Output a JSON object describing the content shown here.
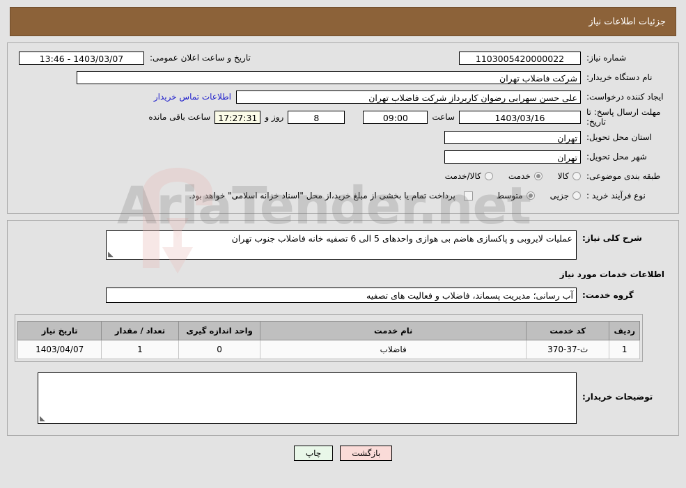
{
  "header": {
    "title": "جزئیات اطلاعات نیاز"
  },
  "watermark": {
    "text": "AriaTender.net",
    "logo_color": "#e8b9b6"
  },
  "form": {
    "need_number": {
      "label": "شماره نیاز:",
      "value": "1103005420000022"
    },
    "public_announce": {
      "label": "تاریخ و ساعت اعلان عمومی:",
      "value": "1403/03/07 - 13:46"
    },
    "buyer_org": {
      "label": "نام دستگاه خریدار:",
      "value": "شرکت فاضلاب تهران"
    },
    "creator": {
      "label": "ایجاد کننده درخواست:",
      "value": "علی حسن  سهرابی رضوان کاربرداز شرکت فاضلاب تهران"
    },
    "contact_link": "اطلاعات تماس خریدار",
    "deadline": {
      "label": "مهلت ارسال پاسخ: تا تاریخ:",
      "date": "1403/03/16",
      "hour_label": "ساعت",
      "hour": "09:00",
      "days": "8",
      "days_label": "روز و",
      "countdown": "17:27:31",
      "countdown_label": "ساعت باقی مانده"
    },
    "delivery_province": {
      "label": "استان محل تحویل:",
      "value": "تهران"
    },
    "delivery_city": {
      "label": "شهر محل تحویل:",
      "value": "تهران"
    },
    "category": {
      "label": "طبقه بندی موضوعی:",
      "options": [
        {
          "label": "کالا",
          "selected": false
        },
        {
          "label": "خدمت",
          "selected": true
        },
        {
          "label": "کالا/خدمت",
          "selected": false
        }
      ]
    },
    "purchase_type": {
      "label": "نوع فرآیند خرید :",
      "options": [
        {
          "label": "جزیی",
          "selected": false
        },
        {
          "label": "متوسط",
          "selected": true
        }
      ],
      "treasury_note": "پرداخت تمام یا بخشی از مبلغ خرید،از محل \"اسناد خزانه اسلامی\" خواهد بود.",
      "treasury_checked": false
    }
  },
  "details": {
    "general_desc": {
      "label": "شرح کلی نیاز:",
      "value": "عملیات لایروبی و پاکسازی هاضم بی هوازی واحدهای 5 الی 6 تصفیه خانه فاضلاب جنوب تهران"
    },
    "section_title": "اطلاعات خدمات مورد نیاز",
    "service_group": {
      "label": "گروه خدمت:",
      "value": "آب رسانی؛ مدیریت پسماند، فاضلاب و فعالیت های تصفیه"
    },
    "table": {
      "columns": [
        "ردیف",
        "کد خدمت",
        "نام خدمت",
        "واحد اندازه گیری",
        "تعداد / مقدار",
        "تاریخ نیاز"
      ],
      "rows": [
        {
          "index": "1",
          "code": "ث-37-370",
          "name": "فاضلاب",
          "unit": "0",
          "qty": "1",
          "date": "1403/04/07"
        }
      ]
    },
    "buyer_notes": {
      "label": "توضیحات خریدار:",
      "value": ""
    }
  },
  "footer": {
    "print_label": "چاپ",
    "back_label": "بازگشت"
  }
}
